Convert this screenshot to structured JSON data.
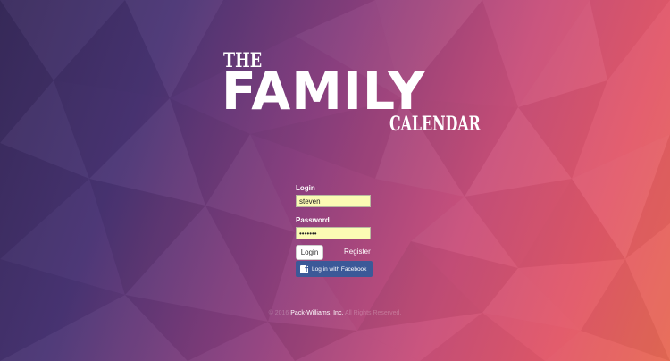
{
  "logo": {
    "the": "THE",
    "family": "FAMILY",
    "calendar": "CALENDAR"
  },
  "form": {
    "login_label": "Login",
    "login_value": "steven",
    "password_label": "Password",
    "password_value": "•••••••",
    "login_button": "Login",
    "register_link": "Register",
    "facebook_icon_glyph": "f",
    "facebook_button": "Log in with Facebook"
  },
  "footer": {
    "copyright_prefix": "© 2016",
    "owner": "Pack-Williams, Inc.",
    "rights": "All Rights Reserved."
  },
  "colors": {
    "facebook_blue": "#3b5998",
    "input_autofill": "#fbfbb4",
    "background_left": "#3a2c5e",
    "background_right": "#e86b55"
  }
}
